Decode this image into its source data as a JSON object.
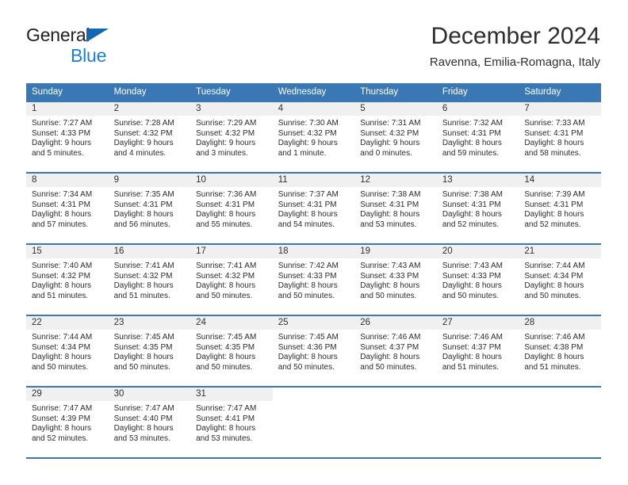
{
  "brand": {
    "line1": "General",
    "line2": "Blue",
    "triangle_color": "#1368b4",
    "line2_color": "#1b7fd4"
  },
  "header": {
    "title": "December 2024",
    "subtitle": "Ravenna, Emilia-Romagna, Italy"
  },
  "theme": {
    "header_bg": "#3a78b5",
    "daynum_bg": "#f0f0f0",
    "text": "#2b2b2b"
  },
  "weekdays": [
    "Sunday",
    "Monday",
    "Tuesday",
    "Wednesday",
    "Thursday",
    "Friday",
    "Saturday"
  ],
  "weeks": [
    [
      {
        "day": "1",
        "sunrise": "Sunrise: 7:27 AM",
        "sunset": "Sunset: 4:33 PM",
        "daylight1": "Daylight: 9 hours",
        "daylight2": "and 5 minutes."
      },
      {
        "day": "2",
        "sunrise": "Sunrise: 7:28 AM",
        "sunset": "Sunset: 4:32 PM",
        "daylight1": "Daylight: 9 hours",
        "daylight2": "and 4 minutes."
      },
      {
        "day": "3",
        "sunrise": "Sunrise: 7:29 AM",
        "sunset": "Sunset: 4:32 PM",
        "daylight1": "Daylight: 9 hours",
        "daylight2": "and 3 minutes."
      },
      {
        "day": "4",
        "sunrise": "Sunrise: 7:30 AM",
        "sunset": "Sunset: 4:32 PM",
        "daylight1": "Daylight: 9 hours",
        "daylight2": "and 1 minute."
      },
      {
        "day": "5",
        "sunrise": "Sunrise: 7:31 AM",
        "sunset": "Sunset: 4:32 PM",
        "daylight1": "Daylight: 9 hours",
        "daylight2": "and 0 minutes."
      },
      {
        "day": "6",
        "sunrise": "Sunrise: 7:32 AM",
        "sunset": "Sunset: 4:31 PM",
        "daylight1": "Daylight: 8 hours",
        "daylight2": "and 59 minutes."
      },
      {
        "day": "7",
        "sunrise": "Sunrise: 7:33 AM",
        "sunset": "Sunset: 4:31 PM",
        "daylight1": "Daylight: 8 hours",
        "daylight2": "and 58 minutes."
      }
    ],
    [
      {
        "day": "8",
        "sunrise": "Sunrise: 7:34 AM",
        "sunset": "Sunset: 4:31 PM",
        "daylight1": "Daylight: 8 hours",
        "daylight2": "and 57 minutes."
      },
      {
        "day": "9",
        "sunrise": "Sunrise: 7:35 AM",
        "sunset": "Sunset: 4:31 PM",
        "daylight1": "Daylight: 8 hours",
        "daylight2": "and 56 minutes."
      },
      {
        "day": "10",
        "sunrise": "Sunrise: 7:36 AM",
        "sunset": "Sunset: 4:31 PM",
        "daylight1": "Daylight: 8 hours",
        "daylight2": "and 55 minutes."
      },
      {
        "day": "11",
        "sunrise": "Sunrise: 7:37 AM",
        "sunset": "Sunset: 4:31 PM",
        "daylight1": "Daylight: 8 hours",
        "daylight2": "and 54 minutes."
      },
      {
        "day": "12",
        "sunrise": "Sunrise: 7:38 AM",
        "sunset": "Sunset: 4:31 PM",
        "daylight1": "Daylight: 8 hours",
        "daylight2": "and 53 minutes."
      },
      {
        "day": "13",
        "sunrise": "Sunrise: 7:38 AM",
        "sunset": "Sunset: 4:31 PM",
        "daylight1": "Daylight: 8 hours",
        "daylight2": "and 52 minutes."
      },
      {
        "day": "14",
        "sunrise": "Sunrise: 7:39 AM",
        "sunset": "Sunset: 4:31 PM",
        "daylight1": "Daylight: 8 hours",
        "daylight2": "and 52 minutes."
      }
    ],
    [
      {
        "day": "15",
        "sunrise": "Sunrise: 7:40 AM",
        "sunset": "Sunset: 4:32 PM",
        "daylight1": "Daylight: 8 hours",
        "daylight2": "and 51 minutes."
      },
      {
        "day": "16",
        "sunrise": "Sunrise: 7:41 AM",
        "sunset": "Sunset: 4:32 PM",
        "daylight1": "Daylight: 8 hours",
        "daylight2": "and 51 minutes."
      },
      {
        "day": "17",
        "sunrise": "Sunrise: 7:41 AM",
        "sunset": "Sunset: 4:32 PM",
        "daylight1": "Daylight: 8 hours",
        "daylight2": "and 50 minutes."
      },
      {
        "day": "18",
        "sunrise": "Sunrise: 7:42 AM",
        "sunset": "Sunset: 4:33 PM",
        "daylight1": "Daylight: 8 hours",
        "daylight2": "and 50 minutes."
      },
      {
        "day": "19",
        "sunrise": "Sunrise: 7:43 AM",
        "sunset": "Sunset: 4:33 PM",
        "daylight1": "Daylight: 8 hours",
        "daylight2": "and 50 minutes."
      },
      {
        "day": "20",
        "sunrise": "Sunrise: 7:43 AM",
        "sunset": "Sunset: 4:33 PM",
        "daylight1": "Daylight: 8 hours",
        "daylight2": "and 50 minutes."
      },
      {
        "day": "21",
        "sunrise": "Sunrise: 7:44 AM",
        "sunset": "Sunset: 4:34 PM",
        "daylight1": "Daylight: 8 hours",
        "daylight2": "and 50 minutes."
      }
    ],
    [
      {
        "day": "22",
        "sunrise": "Sunrise: 7:44 AM",
        "sunset": "Sunset: 4:34 PM",
        "daylight1": "Daylight: 8 hours",
        "daylight2": "and 50 minutes."
      },
      {
        "day": "23",
        "sunrise": "Sunrise: 7:45 AM",
        "sunset": "Sunset: 4:35 PM",
        "daylight1": "Daylight: 8 hours",
        "daylight2": "and 50 minutes."
      },
      {
        "day": "24",
        "sunrise": "Sunrise: 7:45 AM",
        "sunset": "Sunset: 4:35 PM",
        "daylight1": "Daylight: 8 hours",
        "daylight2": "and 50 minutes."
      },
      {
        "day": "25",
        "sunrise": "Sunrise: 7:45 AM",
        "sunset": "Sunset: 4:36 PM",
        "daylight1": "Daylight: 8 hours",
        "daylight2": "and 50 minutes."
      },
      {
        "day": "26",
        "sunrise": "Sunrise: 7:46 AM",
        "sunset": "Sunset: 4:37 PM",
        "daylight1": "Daylight: 8 hours",
        "daylight2": "and 50 minutes."
      },
      {
        "day": "27",
        "sunrise": "Sunrise: 7:46 AM",
        "sunset": "Sunset: 4:37 PM",
        "daylight1": "Daylight: 8 hours",
        "daylight2": "and 51 minutes."
      },
      {
        "day": "28",
        "sunrise": "Sunrise: 7:46 AM",
        "sunset": "Sunset: 4:38 PM",
        "daylight1": "Daylight: 8 hours",
        "daylight2": "and 51 minutes."
      }
    ],
    [
      {
        "day": "29",
        "sunrise": "Sunrise: 7:47 AM",
        "sunset": "Sunset: 4:39 PM",
        "daylight1": "Daylight: 8 hours",
        "daylight2": "and 52 minutes."
      },
      {
        "day": "30",
        "sunrise": "Sunrise: 7:47 AM",
        "sunset": "Sunset: 4:40 PM",
        "daylight1": "Daylight: 8 hours",
        "daylight2": "and 53 minutes."
      },
      {
        "day": "31",
        "sunrise": "Sunrise: 7:47 AM",
        "sunset": "Sunset: 4:41 PM",
        "daylight1": "Daylight: 8 hours",
        "daylight2": "and 53 minutes."
      },
      {
        "day": "",
        "sunrise": "",
        "sunset": "",
        "daylight1": "",
        "daylight2": ""
      },
      {
        "day": "",
        "sunrise": "",
        "sunset": "",
        "daylight1": "",
        "daylight2": ""
      },
      {
        "day": "",
        "sunrise": "",
        "sunset": "",
        "daylight1": "",
        "daylight2": ""
      },
      {
        "day": "",
        "sunrise": "",
        "sunset": "",
        "daylight1": "",
        "daylight2": ""
      }
    ]
  ]
}
